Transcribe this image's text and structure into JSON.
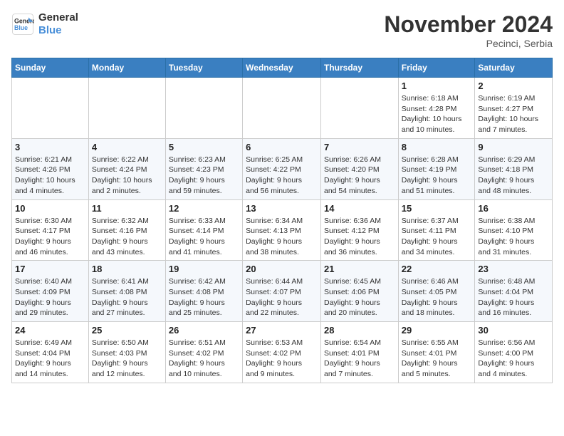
{
  "logo": {
    "line1": "General",
    "line2": "Blue"
  },
  "title": "November 2024",
  "location": "Pecinci, Serbia",
  "weekdays": [
    "Sunday",
    "Monday",
    "Tuesday",
    "Wednesday",
    "Thursday",
    "Friday",
    "Saturday"
  ],
  "weeks": [
    [
      {
        "day": "",
        "info": ""
      },
      {
        "day": "",
        "info": ""
      },
      {
        "day": "",
        "info": ""
      },
      {
        "day": "",
        "info": ""
      },
      {
        "day": "",
        "info": ""
      },
      {
        "day": "1",
        "info": "Sunrise: 6:18 AM\nSunset: 4:28 PM\nDaylight: 10 hours\nand 10 minutes."
      },
      {
        "day": "2",
        "info": "Sunrise: 6:19 AM\nSunset: 4:27 PM\nDaylight: 10 hours\nand 7 minutes."
      }
    ],
    [
      {
        "day": "3",
        "info": "Sunrise: 6:21 AM\nSunset: 4:26 PM\nDaylight: 10 hours\nand 4 minutes."
      },
      {
        "day": "4",
        "info": "Sunrise: 6:22 AM\nSunset: 4:24 PM\nDaylight: 10 hours\nand 2 minutes."
      },
      {
        "day": "5",
        "info": "Sunrise: 6:23 AM\nSunset: 4:23 PM\nDaylight: 9 hours\nand 59 minutes."
      },
      {
        "day": "6",
        "info": "Sunrise: 6:25 AM\nSunset: 4:22 PM\nDaylight: 9 hours\nand 56 minutes."
      },
      {
        "day": "7",
        "info": "Sunrise: 6:26 AM\nSunset: 4:20 PM\nDaylight: 9 hours\nand 54 minutes."
      },
      {
        "day": "8",
        "info": "Sunrise: 6:28 AM\nSunset: 4:19 PM\nDaylight: 9 hours\nand 51 minutes."
      },
      {
        "day": "9",
        "info": "Sunrise: 6:29 AM\nSunset: 4:18 PM\nDaylight: 9 hours\nand 48 minutes."
      }
    ],
    [
      {
        "day": "10",
        "info": "Sunrise: 6:30 AM\nSunset: 4:17 PM\nDaylight: 9 hours\nand 46 minutes."
      },
      {
        "day": "11",
        "info": "Sunrise: 6:32 AM\nSunset: 4:16 PM\nDaylight: 9 hours\nand 43 minutes."
      },
      {
        "day": "12",
        "info": "Sunrise: 6:33 AM\nSunset: 4:14 PM\nDaylight: 9 hours\nand 41 minutes."
      },
      {
        "day": "13",
        "info": "Sunrise: 6:34 AM\nSunset: 4:13 PM\nDaylight: 9 hours\nand 38 minutes."
      },
      {
        "day": "14",
        "info": "Sunrise: 6:36 AM\nSunset: 4:12 PM\nDaylight: 9 hours\nand 36 minutes."
      },
      {
        "day": "15",
        "info": "Sunrise: 6:37 AM\nSunset: 4:11 PM\nDaylight: 9 hours\nand 34 minutes."
      },
      {
        "day": "16",
        "info": "Sunrise: 6:38 AM\nSunset: 4:10 PM\nDaylight: 9 hours\nand 31 minutes."
      }
    ],
    [
      {
        "day": "17",
        "info": "Sunrise: 6:40 AM\nSunset: 4:09 PM\nDaylight: 9 hours\nand 29 minutes."
      },
      {
        "day": "18",
        "info": "Sunrise: 6:41 AM\nSunset: 4:08 PM\nDaylight: 9 hours\nand 27 minutes."
      },
      {
        "day": "19",
        "info": "Sunrise: 6:42 AM\nSunset: 4:08 PM\nDaylight: 9 hours\nand 25 minutes."
      },
      {
        "day": "20",
        "info": "Sunrise: 6:44 AM\nSunset: 4:07 PM\nDaylight: 9 hours\nand 22 minutes."
      },
      {
        "day": "21",
        "info": "Sunrise: 6:45 AM\nSunset: 4:06 PM\nDaylight: 9 hours\nand 20 minutes."
      },
      {
        "day": "22",
        "info": "Sunrise: 6:46 AM\nSunset: 4:05 PM\nDaylight: 9 hours\nand 18 minutes."
      },
      {
        "day": "23",
        "info": "Sunrise: 6:48 AM\nSunset: 4:04 PM\nDaylight: 9 hours\nand 16 minutes."
      }
    ],
    [
      {
        "day": "24",
        "info": "Sunrise: 6:49 AM\nSunset: 4:04 PM\nDaylight: 9 hours\nand 14 minutes."
      },
      {
        "day": "25",
        "info": "Sunrise: 6:50 AM\nSunset: 4:03 PM\nDaylight: 9 hours\nand 12 minutes."
      },
      {
        "day": "26",
        "info": "Sunrise: 6:51 AM\nSunset: 4:02 PM\nDaylight: 9 hours\nand 10 minutes."
      },
      {
        "day": "27",
        "info": "Sunrise: 6:53 AM\nSunset: 4:02 PM\nDaylight: 9 hours\nand 9 minutes."
      },
      {
        "day": "28",
        "info": "Sunrise: 6:54 AM\nSunset: 4:01 PM\nDaylight: 9 hours\nand 7 minutes."
      },
      {
        "day": "29",
        "info": "Sunrise: 6:55 AM\nSunset: 4:01 PM\nDaylight: 9 hours\nand 5 minutes."
      },
      {
        "day": "30",
        "info": "Sunrise: 6:56 AM\nSunset: 4:00 PM\nDaylight: 9 hours\nand 4 minutes."
      }
    ]
  ]
}
